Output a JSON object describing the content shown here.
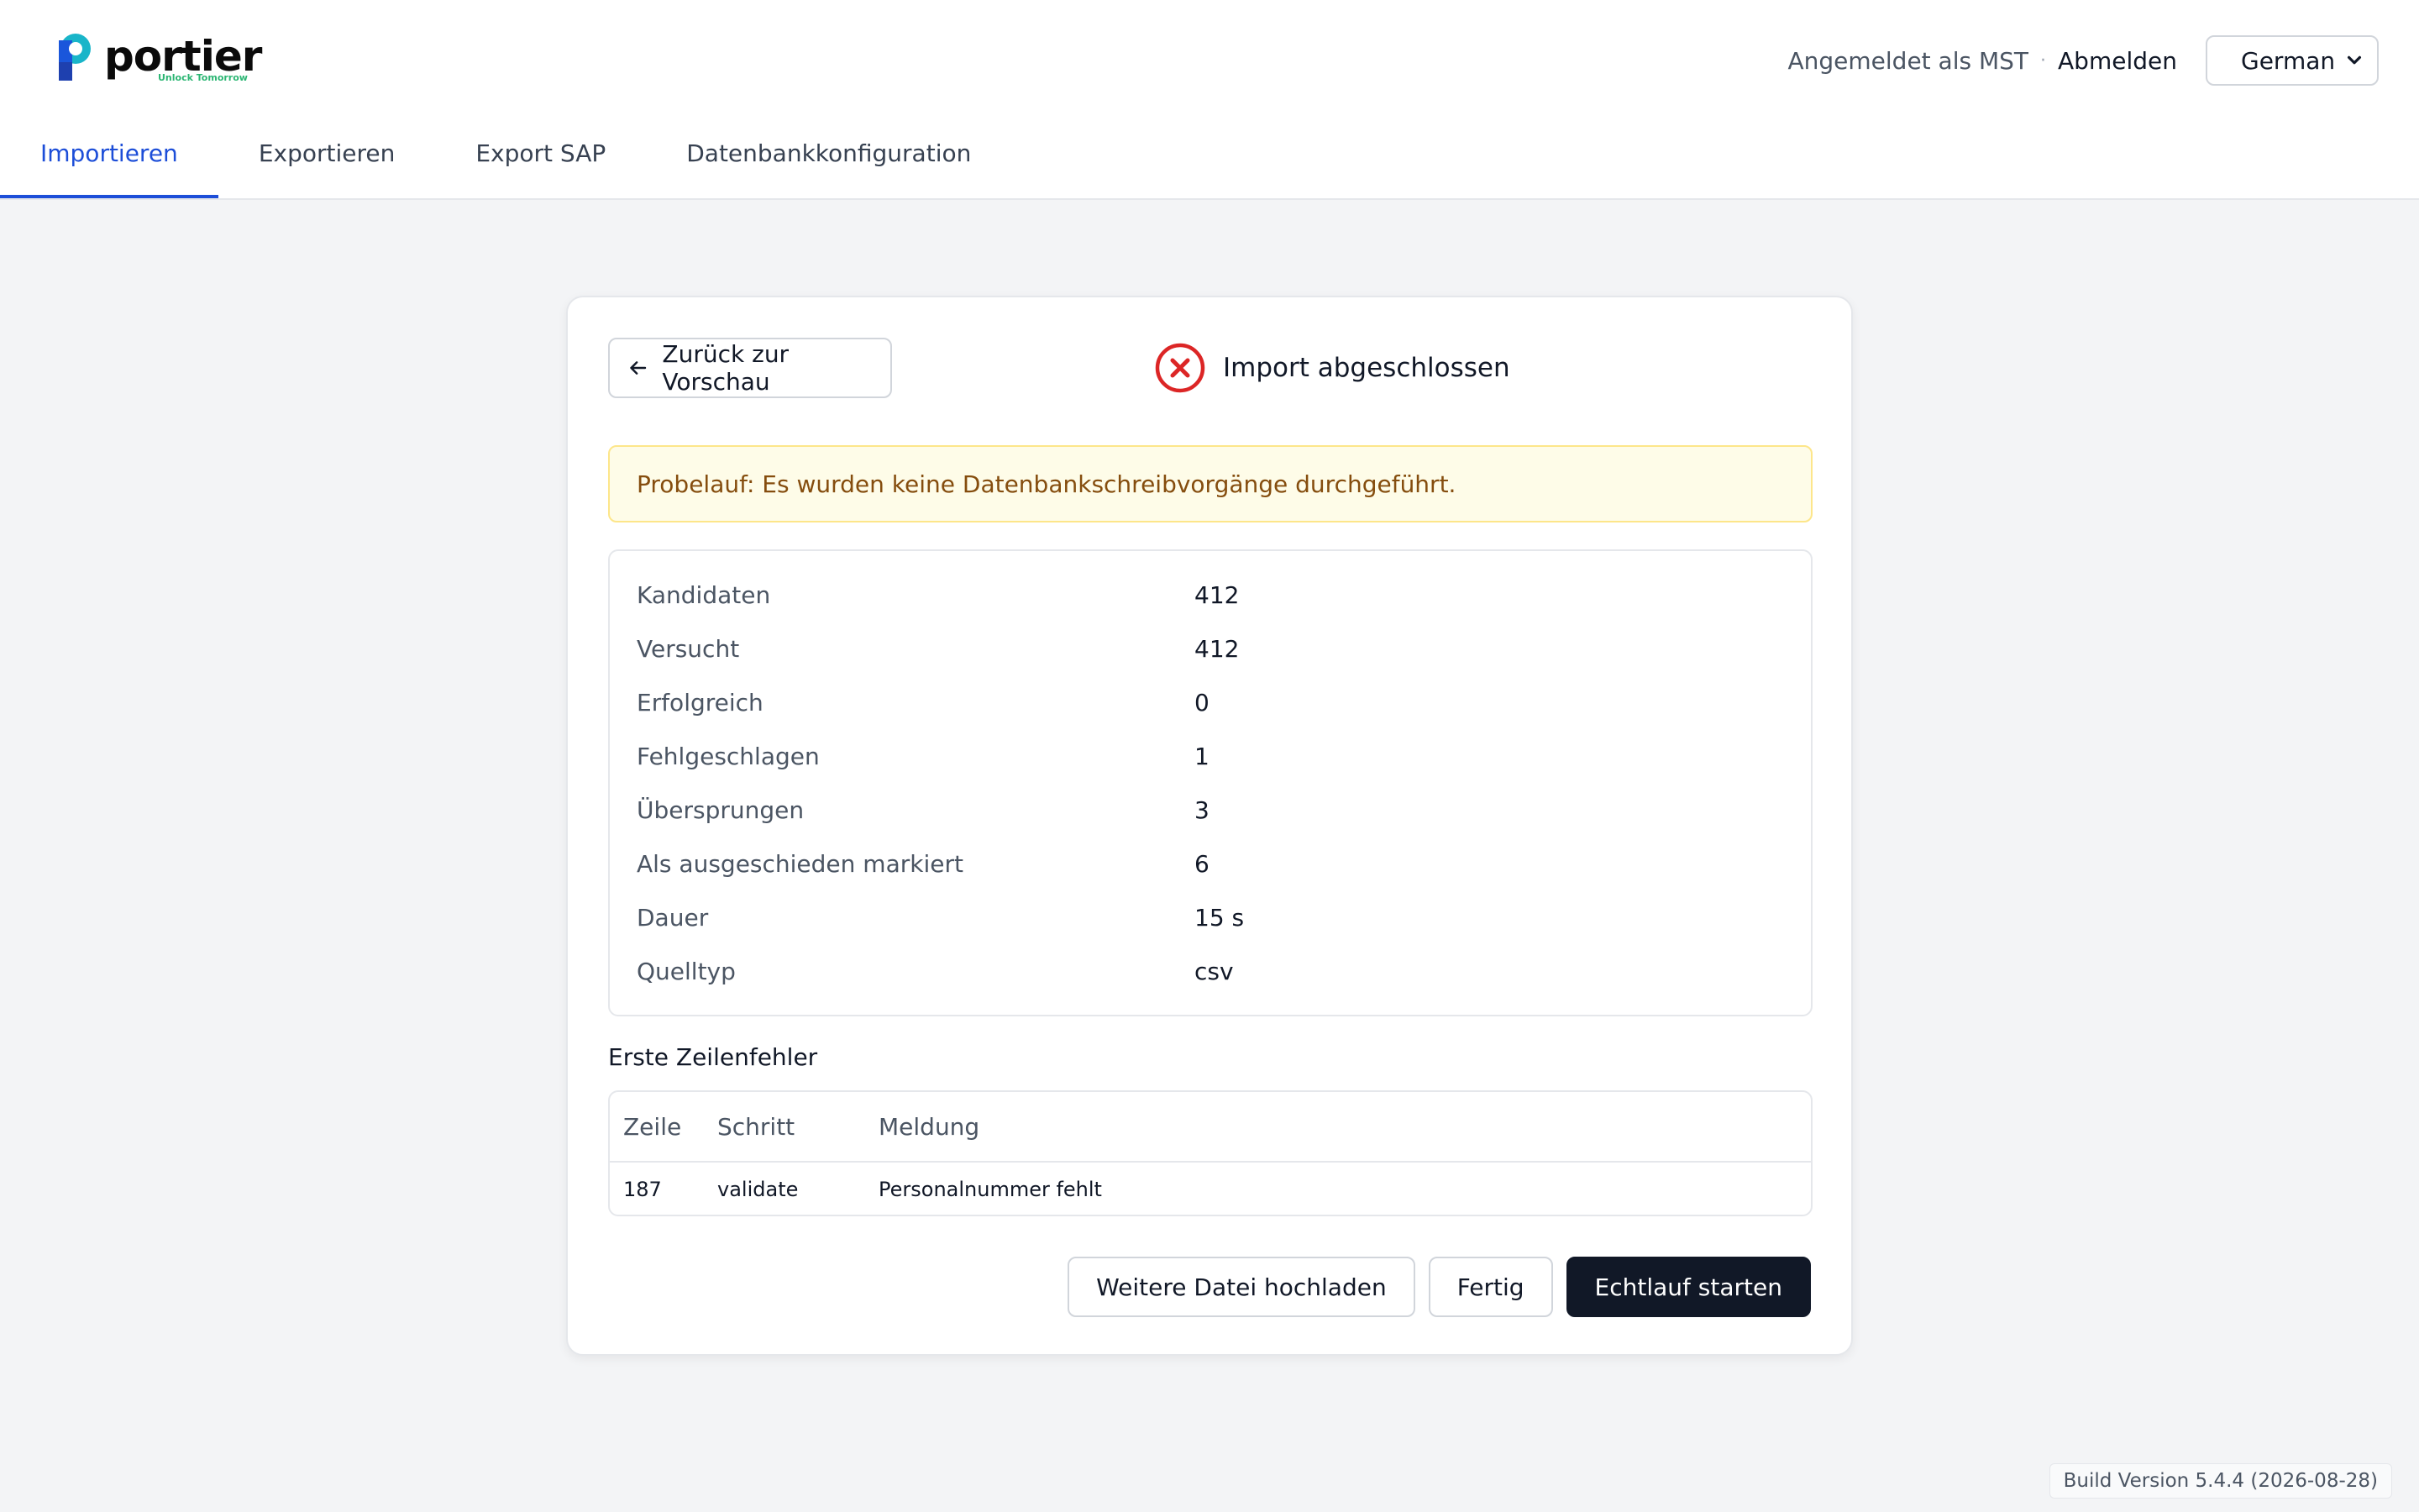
{
  "brand": {
    "name": "portier",
    "tagline": "Unlock Tomorrow",
    "colors": {
      "blue": "#1a56db",
      "teal": "#19b5c9",
      "green": "#2bb673"
    }
  },
  "header": {
    "signed_in_as": "Angemeldet als MST",
    "separator": "·",
    "logout_label": "Abmelden",
    "language": {
      "selected": "German"
    }
  },
  "nav": {
    "tabs": [
      {
        "label": "Importieren",
        "active": true
      },
      {
        "label": "Exportieren",
        "active": false
      },
      {
        "label": "Export SAP",
        "active": false
      },
      {
        "label": "Datenbankkonfiguration",
        "active": false
      }
    ]
  },
  "card": {
    "back_label": "Zurück zur Vorschau",
    "status": {
      "title": "Import abgeschlossen",
      "icon": "error-circle-icon",
      "color": "#dc2626"
    },
    "alert": "Probelauf: Es wurden keine Datenbankschreibvorgänge durchgeführt.",
    "stats": [
      {
        "label": "Kandidaten",
        "value": "412"
      },
      {
        "label": "Versucht",
        "value": "412"
      },
      {
        "label": "Erfolgreich",
        "value": "0"
      },
      {
        "label": "Fehlgeschlagen",
        "value": "1"
      },
      {
        "label": "Übersprungen",
        "value": "3"
      },
      {
        "label": "Als ausgeschieden markiert",
        "value": "6"
      },
      {
        "label": "Dauer",
        "value": "15 s"
      },
      {
        "label": "Quelltyp",
        "value": "csv"
      }
    ],
    "errors": {
      "title": "Erste Zeilenfehler",
      "columns": [
        "Zeile",
        "Schritt",
        "Meldung"
      ],
      "rows": [
        {
          "line": "187",
          "step": "validate",
          "message": "Personalnummer fehlt"
        }
      ]
    },
    "actions": {
      "upload_more": "Weitere Datei hochladen",
      "done": "Fertig",
      "start_live": "Echtlauf starten"
    }
  },
  "footer": {
    "build": "Build Version 5.4.4 (2026-08-28)"
  }
}
